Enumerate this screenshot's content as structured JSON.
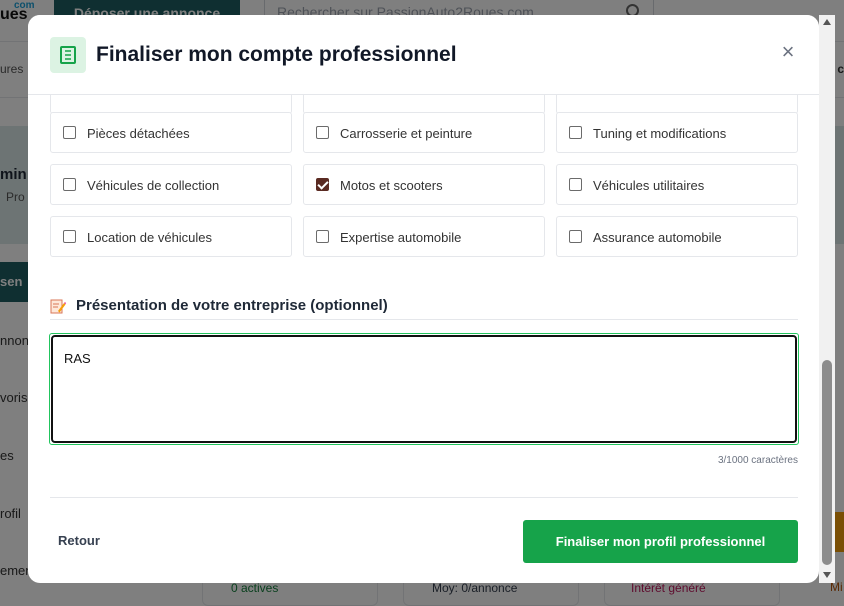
{
  "background": {
    "logo": "ues",
    "logo_dot": "com",
    "post_ad_button": "Déposer une annonce",
    "search_placeholder": "Rechercher sur PassionAuto2Roues.com",
    "subnav_left": "ures",
    "subnav_right": "c",
    "hero_title": "min",
    "hero_sub": "Pro",
    "side_tab": "sen",
    "side_items": [
      "nnonc",
      "voris",
      "es",
      "rofil",
      "emen"
    ],
    "bottom_cards": [
      "0 actives",
      "Moy: 0/annonce",
      "Intérêt généré",
      "Mi"
    ]
  },
  "modal": {
    "title": "Finaliser mon compte professionnel",
    "close_label": "×",
    "options": [
      {
        "label": "Pièces détachées",
        "checked": false
      },
      {
        "label": "Carrosserie et peinture",
        "checked": false
      },
      {
        "label": "Tuning et modifications",
        "checked": false
      },
      {
        "label": "Véhicules de collection",
        "checked": false
      },
      {
        "label": "Motos et scooters",
        "checked": true
      },
      {
        "label": "Véhicules utilitaires",
        "checked": false
      },
      {
        "label": "Location de véhicules",
        "checked": false
      },
      {
        "label": "Expertise automobile",
        "checked": false
      },
      {
        "label": "Assurance automobile",
        "checked": false
      }
    ],
    "presentation": {
      "title": "Présentation de votre entreprise (optionnel)",
      "value": "RAS",
      "counter": "3/1000 caractères"
    },
    "back_label": "Retour",
    "submit_label": "Finaliser mon profil professionnel"
  },
  "colors": {
    "primary_green": "#16a34a",
    "checkbox_checked": "#5a2a22",
    "icon_bg": "#dcf3e3"
  }
}
